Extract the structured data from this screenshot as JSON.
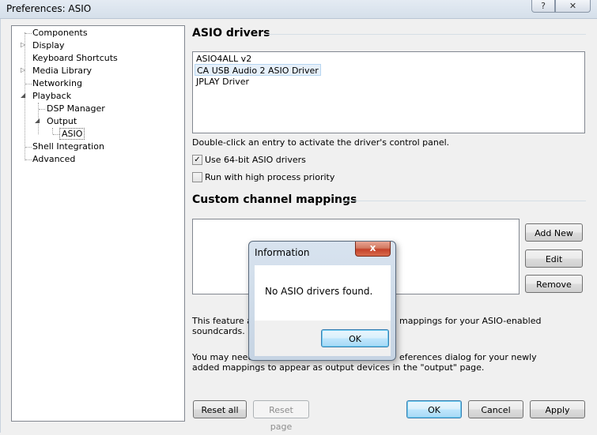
{
  "window": {
    "title": "Preferences: ASIO",
    "help_glyph": "?",
    "close_glyph": "✕"
  },
  "tree": {
    "items": [
      {
        "label": "Components"
      },
      {
        "label": "Display"
      },
      {
        "label": "Keyboard Shortcuts"
      },
      {
        "label": "Media Library"
      },
      {
        "label": "Networking"
      },
      {
        "label": "Playback"
      },
      {
        "label": "DSP Manager"
      },
      {
        "label": "Output"
      },
      {
        "label": "ASIO"
      },
      {
        "label": "Shell Integration"
      },
      {
        "label": "Advanced"
      }
    ],
    "expander_collapsed": "▷",
    "expander_expanded": "◢"
  },
  "asio": {
    "title": "ASIO drivers",
    "drivers": [
      {
        "label": "ASIO4ALL v2"
      },
      {
        "label": "CA USB Audio 2 ASIO Driver"
      },
      {
        "label": "JPLAY Driver"
      }
    ],
    "selected_driver": "CA USB Audio 2 ASIO Driver",
    "hint": "Double-click an entry to activate the driver's control panel.",
    "use64_label": "Use 64-bit ASIO drivers",
    "use64_checked": true,
    "priority_label": "Run with high process priority",
    "priority_checked": false,
    "check_mark": "✓"
  },
  "mappings": {
    "title": "Custom channel mappings",
    "add_new_label": "Add New",
    "edit_label": "Edit",
    "remove_label": "Remove",
    "info1_line1_a": "This feature all",
    "info1_line1_b": "mappings for your ASIO-enabled",
    "info1_line2": "soundcards.",
    "info2_line1_a": "You may need",
    "info2_line1_b": "eferences dialog for your newly",
    "info2_line2": "added mappings to appear as output devices in the \"output\" page."
  },
  "footer": {
    "reset_all_label": "Reset all",
    "reset_page_label": "Reset page",
    "ok_label": "OK",
    "cancel_label": "Cancel",
    "apply_label": "Apply"
  },
  "dialog": {
    "title": "Information",
    "close_glyph": "x",
    "message": "No ASIO drivers found.",
    "ok_label": "OK"
  }
}
